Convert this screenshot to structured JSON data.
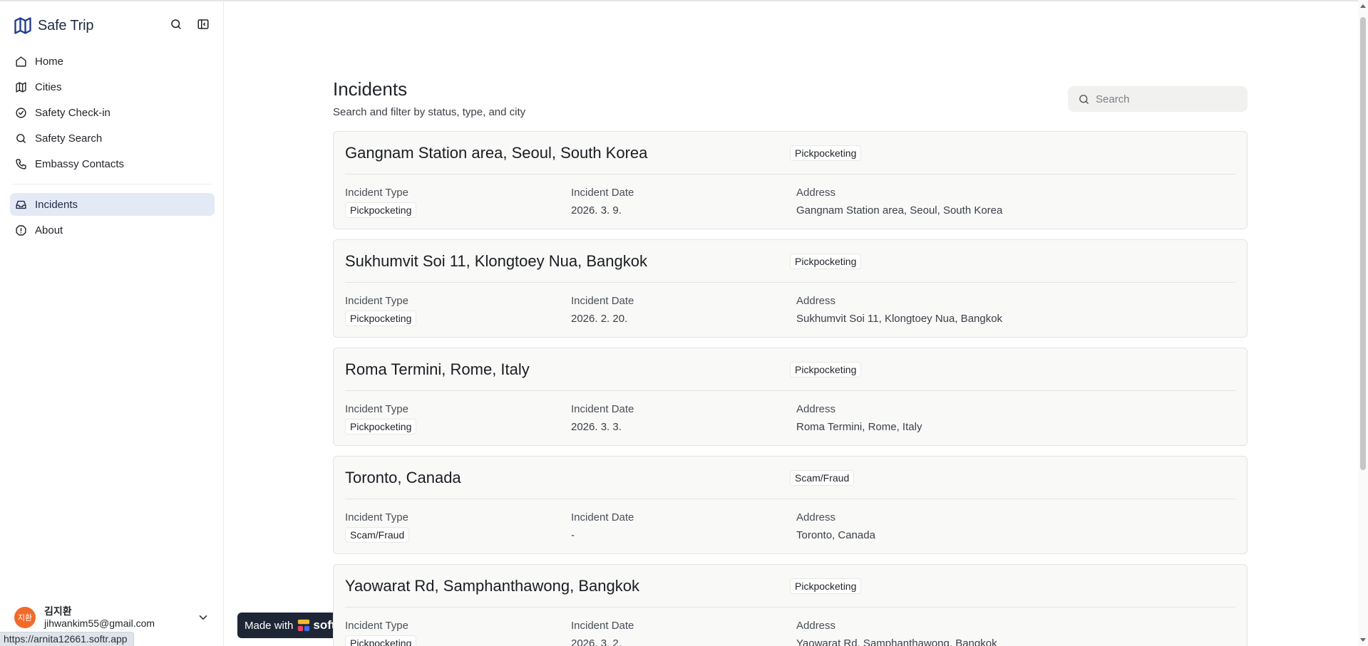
{
  "app": {
    "name": "Safe Trip"
  },
  "sidebar": {
    "items": [
      {
        "label": "Home",
        "icon": "home-icon"
      },
      {
        "label": "Cities",
        "icon": "map-icon"
      },
      {
        "label": "Safety Check-in",
        "icon": "check-circle-icon"
      },
      {
        "label": "Safety Search",
        "icon": "search-icon"
      },
      {
        "label": "Embassy Contacts",
        "icon": "phone-icon"
      },
      {
        "label": "Incidents",
        "icon": "inbox-icon",
        "active": true
      },
      {
        "label": "About",
        "icon": "info-octagon-icon"
      }
    ]
  },
  "user": {
    "initials": "지환",
    "name": "김지환",
    "email": "jihwankim55@gmail.com"
  },
  "status_url": "https://arnita12661.softr.app",
  "badge": {
    "prefix": "Made with",
    "brand": "softr"
  },
  "page": {
    "title": "Incidents",
    "subtitle": "Search and filter by status, type, and city",
    "search_placeholder": "Search"
  },
  "labels": {
    "type": "Incident Type",
    "date": "Incident Date",
    "address": "Address"
  },
  "incidents": [
    {
      "title": "Gangnam Station area, Seoul, South Korea",
      "tag": "Pickpocketing",
      "type": "Pickpocketing",
      "date": "2026. 3. 9.",
      "address": "Gangnam Station area, Seoul, South Korea"
    },
    {
      "title": "Sukhumvit Soi 11, Klongtoey Nua, Bangkok",
      "tag": "Pickpocketing",
      "type": "Pickpocketing",
      "date": "2026. 2. 20.",
      "address": "Sukhumvit Soi 11, Klongtoey Nua, Bangkok"
    },
    {
      "title": "Roma Termini, Rome, Italy",
      "tag": "Pickpocketing",
      "type": "Pickpocketing",
      "date": "2026. 3. 3.",
      "address": "Roma Termini, Rome, Italy"
    },
    {
      "title": "Toronto, Canada",
      "tag": "Scam/Fraud",
      "type": "Scam/Fraud",
      "date": "-",
      "address": "Toronto, Canada"
    },
    {
      "title": "Yaowarat Rd, Samphanthawong, Bangkok",
      "tag": "Pickpocketing",
      "type": "Pickpocketing",
      "date": "2026. 3. 2.",
      "address": "Yaowarat Rd, Samphanthawong, Bangkok"
    }
  ],
  "colors": {
    "brand": "#1f3a8a",
    "active_nav": "#e4e9f6",
    "card_bg": "#f9f9f8",
    "avatar": "#f26a2a",
    "badge_bg": "#1e2636"
  }
}
